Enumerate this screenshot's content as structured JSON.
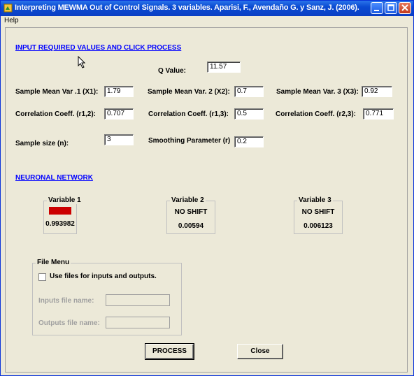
{
  "window": {
    "title": "Interpreting MEWMA Out of Control Signals. 3 variables. Aparisi, F., Avendaño G. y Sanz, J. (2006)."
  },
  "menu": {
    "help": "Help"
  },
  "inputs_heading": "INPUT REQUIRED VALUES AND CLICK PROCESS",
  "q_value": {
    "label": "Q Value:",
    "value": "11.57"
  },
  "means": [
    {
      "label": "Sample Mean Var .1 (X1):",
      "value": "1.79"
    },
    {
      "label": "Sample Mean Var. 2 (X2):",
      "value": "0.7"
    },
    {
      "label": "Sample Mean Var. 3 (X3):",
      "value": "0.92"
    }
  ],
  "correlations": [
    {
      "label": "Correlation Coeff. (r1,2):",
      "value": "0.707"
    },
    {
      "label": "Correlation Coeff. (r1,3):",
      "value": "0.5"
    },
    {
      "label": "Correlation Coeff. (r2,3):",
      "value": "0.771"
    }
  ],
  "sample_size": {
    "label": "Sample size (n):",
    "value": "3"
  },
  "smoothing": {
    "label": "Smoothing Parameter (r)",
    "value": "0.2"
  },
  "network_heading": "NEURONAL NETWORK",
  "variables": [
    {
      "title": "Variable 1",
      "status": "SHIFT",
      "score": "0.993982"
    },
    {
      "title": "Variable 2",
      "status": "NO SHIFT",
      "score": "0.00594"
    },
    {
      "title": "Variable 3",
      "status": "NO SHIFT",
      "score": "0.006123"
    }
  ],
  "file_menu": {
    "title": "File Menu",
    "use_files_label": "Use files for inputs and outputs.",
    "inputs_label": "Inputs file name:",
    "inputs_value": "",
    "outputs_label": "Outputs file name:",
    "outputs_value": ""
  },
  "buttons": {
    "process": "PROCESS",
    "close": "Close"
  },
  "colors": {
    "shift_badge": "#cc0000",
    "link": "#0000ff",
    "titlebar": "#0a4bd2"
  }
}
